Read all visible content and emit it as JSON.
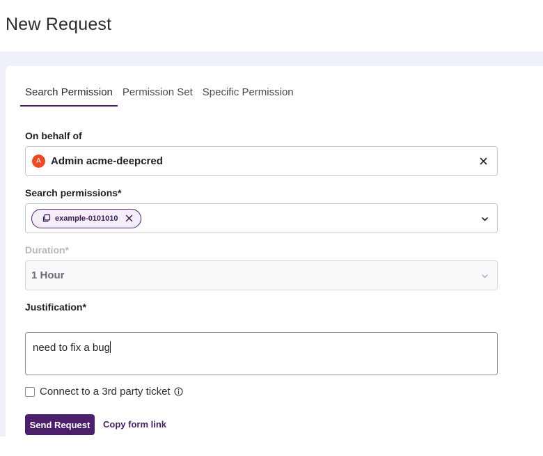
{
  "page": {
    "title": "New Request"
  },
  "tabs": [
    {
      "label": "Search Permission",
      "active": true
    },
    {
      "label": "Permission Set",
      "active": false
    },
    {
      "label": "Specific Permission",
      "active": false
    }
  ],
  "on_behalf_of": {
    "label": "On behalf of",
    "avatar_initial": "A",
    "value": "Admin acme-deepcred"
  },
  "search_permissions": {
    "label": "Search permissions*",
    "chips": [
      {
        "label": "example-0101010"
      }
    ]
  },
  "duration": {
    "label": "Duration*",
    "value": "1 Hour",
    "disabled": true
  },
  "justification": {
    "label": "Justification*",
    "value": "need to fix a bug"
  },
  "ticket": {
    "label": "Connect to a 3rd party ticket",
    "checked": false
  },
  "actions": {
    "send_label": "Send Request",
    "copy_label": "Copy form link"
  },
  "colors": {
    "brand": "#4b1f6b",
    "avatar": "#f04a24",
    "page_bg": "#eef1f9"
  },
  "icons": {
    "clear": "close-icon",
    "chip": "copy-icon",
    "chip_remove": "close-icon",
    "dropdown": "chevron-down-icon",
    "info": "info-icon"
  }
}
